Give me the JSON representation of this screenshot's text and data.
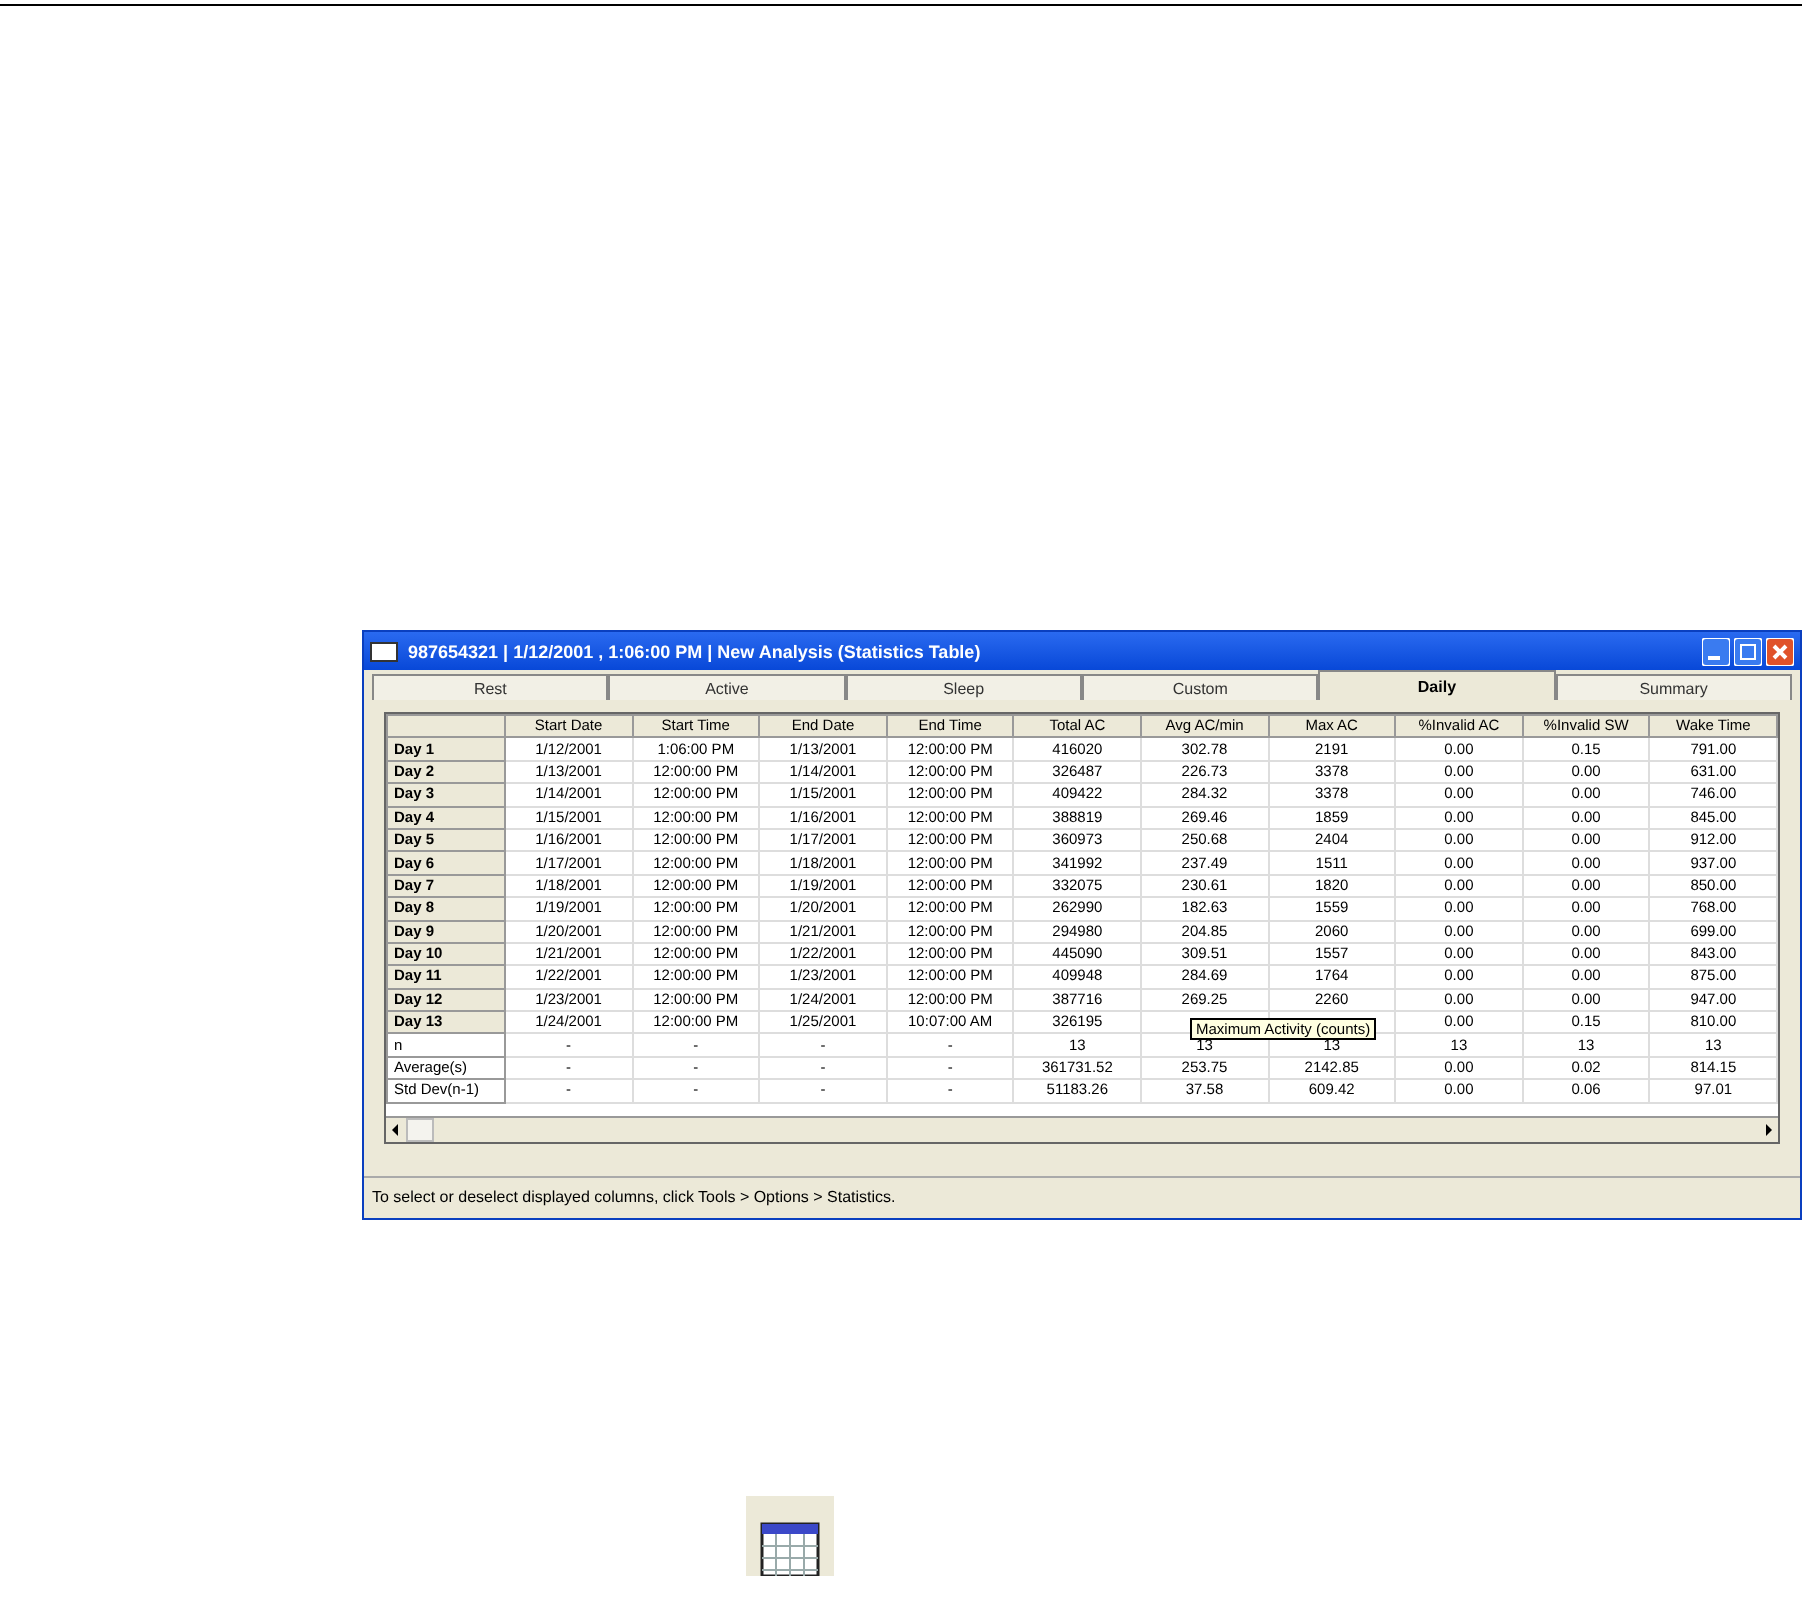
{
  "window": {
    "title": "987654321  |  1/12/2001 , 1:06:00 PM  |  New Analysis (Statistics Table)"
  },
  "tabs": [
    {
      "label": "Rest",
      "selected": false
    },
    {
      "label": "Active",
      "selected": false
    },
    {
      "label": "Sleep",
      "selected": false
    },
    {
      "label": "Custom",
      "selected": false
    },
    {
      "label": "Daily",
      "selected": true
    },
    {
      "label": "Summary",
      "selected": false
    }
  ],
  "table": {
    "columns": [
      "Start Date",
      "Start Time",
      "End Date",
      "End Time",
      "Total AC",
      "Avg AC/min",
      "Max AC",
      "%Invalid AC",
      "%Invalid SW",
      "Wake Time"
    ],
    "rows": [
      {
        "header": "Day 1",
        "kind": "day",
        "cells": [
          "1/12/2001",
          "1:06:00 PM",
          "1/13/2001",
          "12:00:00 PM",
          "416020",
          "302.78",
          "2191",
          "0.00",
          "0.15",
          "791.00"
        ]
      },
      {
        "header": "Day 2",
        "kind": "day",
        "cells": [
          "1/13/2001",
          "12:00:00 PM",
          "1/14/2001",
          "12:00:00 PM",
          "326487",
          "226.73",
          "3378",
          "0.00",
          "0.00",
          "631.00"
        ]
      },
      {
        "header": "Day 3",
        "kind": "day",
        "cells": [
          "1/14/2001",
          "12:00:00 PM",
          "1/15/2001",
          "12:00:00 PM",
          "409422",
          "284.32",
          "3378",
          "0.00",
          "0.00",
          "746.00"
        ]
      },
      {
        "header": "Day 4",
        "kind": "day",
        "cells": [
          "1/15/2001",
          "12:00:00 PM",
          "1/16/2001",
          "12:00:00 PM",
          "388819",
          "269.46",
          "1859",
          "0.00",
          "0.00",
          "845.00"
        ]
      },
      {
        "header": "Day 5",
        "kind": "day",
        "cells": [
          "1/16/2001",
          "12:00:00 PM",
          "1/17/2001",
          "12:00:00 PM",
          "360973",
          "250.68",
          "2404",
          "0.00",
          "0.00",
          "912.00"
        ]
      },
      {
        "header": "Day 6",
        "kind": "day",
        "cells": [
          "1/17/2001",
          "12:00:00 PM",
          "1/18/2001",
          "12:00:00 PM",
          "341992",
          "237.49",
          "1511",
          "0.00",
          "0.00",
          "937.00"
        ]
      },
      {
        "header": "Day 7",
        "kind": "day",
        "cells": [
          "1/18/2001",
          "12:00:00 PM",
          "1/19/2001",
          "12:00:00 PM",
          "332075",
          "230.61",
          "1820",
          "0.00",
          "0.00",
          "850.00"
        ]
      },
      {
        "header": "Day 8",
        "kind": "day",
        "cells": [
          "1/19/2001",
          "12:00:00 PM",
          "1/20/2001",
          "12:00:00 PM",
          "262990",
          "182.63",
          "1559",
          "0.00",
          "0.00",
          "768.00"
        ]
      },
      {
        "header": "Day 9",
        "kind": "day",
        "cells": [
          "1/20/2001",
          "12:00:00 PM",
          "1/21/2001",
          "12:00:00 PM",
          "294980",
          "204.85",
          "2060",
          "0.00",
          "0.00",
          "699.00"
        ]
      },
      {
        "header": "Day 10",
        "kind": "day",
        "cells": [
          "1/21/2001",
          "12:00:00 PM",
          "1/22/2001",
          "12:00:00 PM",
          "445090",
          "309.51",
          "1557",
          "0.00",
          "0.00",
          "843.00"
        ]
      },
      {
        "header": "Day 11",
        "kind": "day",
        "cells": [
          "1/22/2001",
          "12:00:00 PM",
          "1/23/2001",
          "12:00:00 PM",
          "409948",
          "284.69",
          "1764",
          "0.00",
          "0.00",
          "875.00"
        ]
      },
      {
        "header": "Day 12",
        "kind": "day",
        "cells": [
          "1/23/2001",
          "12:00:00 PM",
          "1/24/2001",
          "12:00:00 PM",
          "387716",
          "269.25",
          "2260",
          "0.00",
          "0.00",
          "947.00"
        ]
      },
      {
        "header": "Day 13",
        "kind": "day",
        "cells": [
          "1/24/2001",
          "12:00:00 PM",
          "1/25/2001",
          "10:07:00 AM",
          "326195",
          null,
          null,
          "0.00",
          "0.15",
          "810.00"
        ]
      },
      {
        "header": "n",
        "kind": "stat",
        "cells": [
          "-",
          "-",
          "-",
          "-",
          "13",
          "13",
          "13",
          "13",
          "13",
          "13"
        ]
      },
      {
        "header": "Average(s)",
        "kind": "stat",
        "cells": [
          "-",
          "-",
          "-",
          "-",
          "361731.52",
          "253.75",
          "2142.85",
          "0.00",
          "0.02",
          "814.15"
        ]
      },
      {
        "header": "Std Dev(n-1)",
        "kind": "stat",
        "cells": [
          "-",
          "-",
          "-",
          "-",
          "51183.26",
          "37.58",
          "609.42",
          "0.00",
          "0.06",
          "97.01"
        ]
      }
    ]
  },
  "tooltip": "Maximum Activity (counts)",
  "status_bar": "To select or deselect displayed columns, click Tools > Options > Statistics."
}
